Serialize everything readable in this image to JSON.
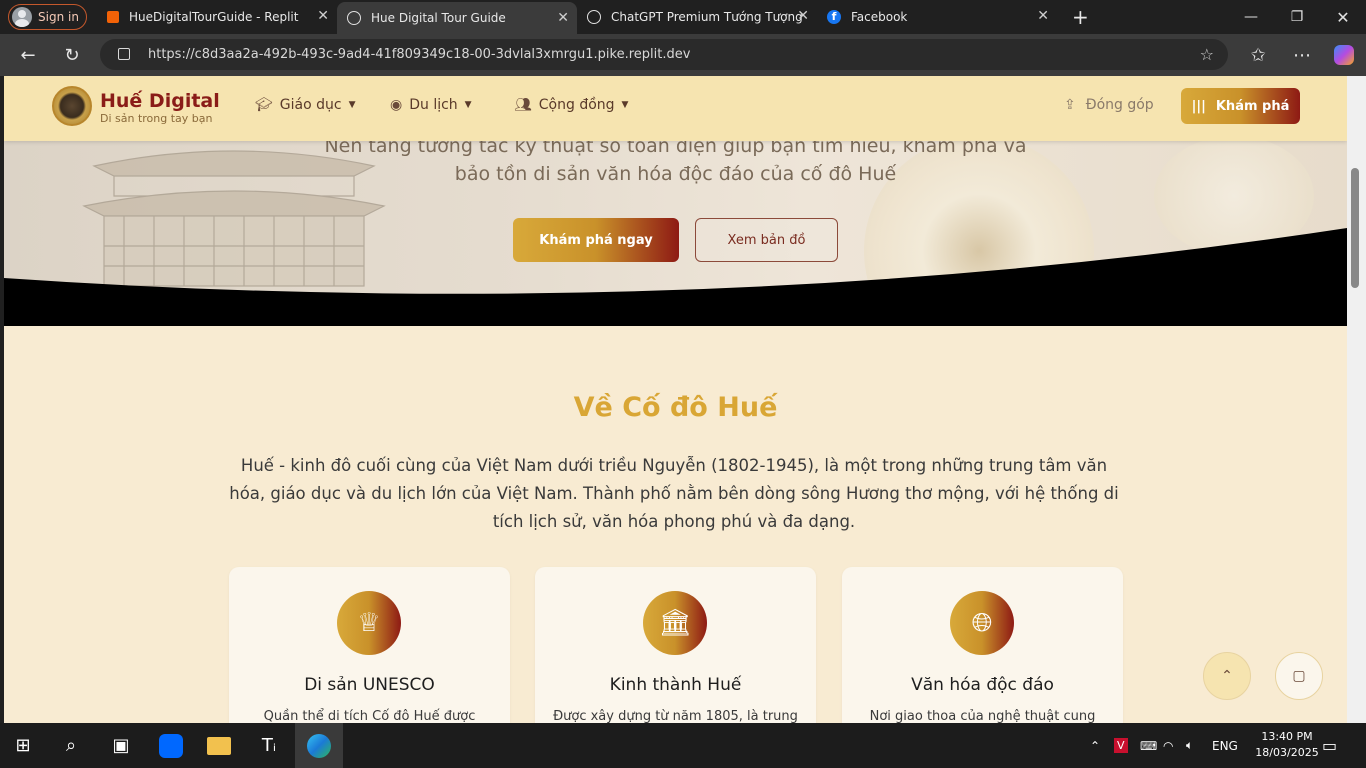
{
  "browser": {
    "signin_label": "Sign in",
    "tabs": [
      {
        "title": "HueDigitalTourGuide - Replit",
        "icon": "replit-icon"
      },
      {
        "title": "Hue Digital Tour Guide",
        "icon": "globe-icon"
      },
      {
        "title": "ChatGPT Premium Tướng Tượng",
        "icon": "chatgpt-icon"
      },
      {
        "title": "Facebook",
        "icon": "facebook-icon"
      }
    ],
    "new_tab": "+",
    "url": "https://c8d3aa2a-492b-493c-9ad4-41f809349c18-00-3dvlal3xmrgu1.pike.replit.dev"
  },
  "site": {
    "brand": "Huế Digital",
    "tagline": "Di sản trong tay bạn",
    "nav": [
      {
        "label": "Giáo dục",
        "icon": "graduation-cap-icon"
      },
      {
        "label": "Du lịch",
        "icon": "map-pin-icon"
      },
      {
        "label": "Cộng đồng",
        "icon": "users-icon"
      }
    ],
    "contribute_label": "Đóng góp",
    "explore_label": "Khám phá",
    "accent_gold": "#d8a93a",
    "accent_red": "#8e1a14"
  },
  "hero": {
    "line1": "Nền tảng tương tác kỹ thuật số toàn diện giúp bạn tìm hiểu, khám phá và",
    "line2": "bảo tồn di sản văn hóa độc đáo của cố đô Huế",
    "primary_button": "Khám phá ngay",
    "secondary_button": "Xem bản đồ"
  },
  "about": {
    "title": "Về Cố đô Huế",
    "text": "Huế - kinh đô cuối cùng của Việt Nam dưới triều Nguyễn (1802-1945), là một trong những trung tâm văn hóa, giáo dục và du lịch lớn của Việt Nam. Thành phố nằm bên dòng sông Hương thơ mộng, với hệ thống di tích lịch sử, văn hóa phong phú và đa dạng.",
    "cards": [
      {
        "title": "Di sản UNESCO",
        "desc": "Quần thể di tích Cố đô Huế được",
        "icon": "crown-icon"
      },
      {
        "title": "Kinh thành Huế",
        "desc": "Được xây dựng từ năm 1805, là trung",
        "icon": "landmark-icon"
      },
      {
        "title": "Văn hóa độc đáo",
        "desc": "Nơi giao thoa của nghệ thuật cung",
        "icon": "globe-icon"
      }
    ]
  },
  "taskbar": {
    "language": "ENG",
    "time": "13:40 PM",
    "date": "18/03/2025"
  }
}
